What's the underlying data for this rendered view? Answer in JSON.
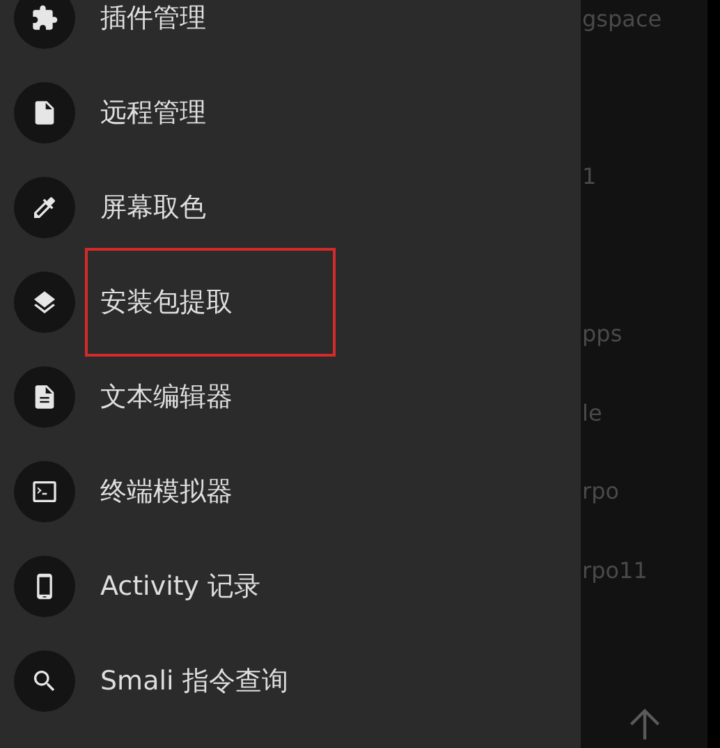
{
  "drawer": {
    "items": [
      {
        "kind": "puzzle",
        "label": "插件管理",
        "highlighted": false
      },
      {
        "kind": "file",
        "label": "远程管理",
        "highlighted": false
      },
      {
        "kind": "eyedropper",
        "label": "屏幕取色",
        "highlighted": false
      },
      {
        "kind": "layers",
        "label": "安装包提取",
        "highlighted": true
      },
      {
        "kind": "document",
        "label": "文本编辑器",
        "highlighted": false
      },
      {
        "kind": "terminal",
        "label": "终端模拟器",
        "highlighted": false
      },
      {
        "kind": "phone",
        "label": "Activity 记录",
        "highlighted": false
      },
      {
        "kind": "search",
        "label": "Smali 指令查询",
        "highlighted": false
      }
    ]
  },
  "file_list": {
    "items": [
      "gspace",
      "1",
      "pps",
      "le",
      "rpo",
      "rpo11"
    ]
  }
}
